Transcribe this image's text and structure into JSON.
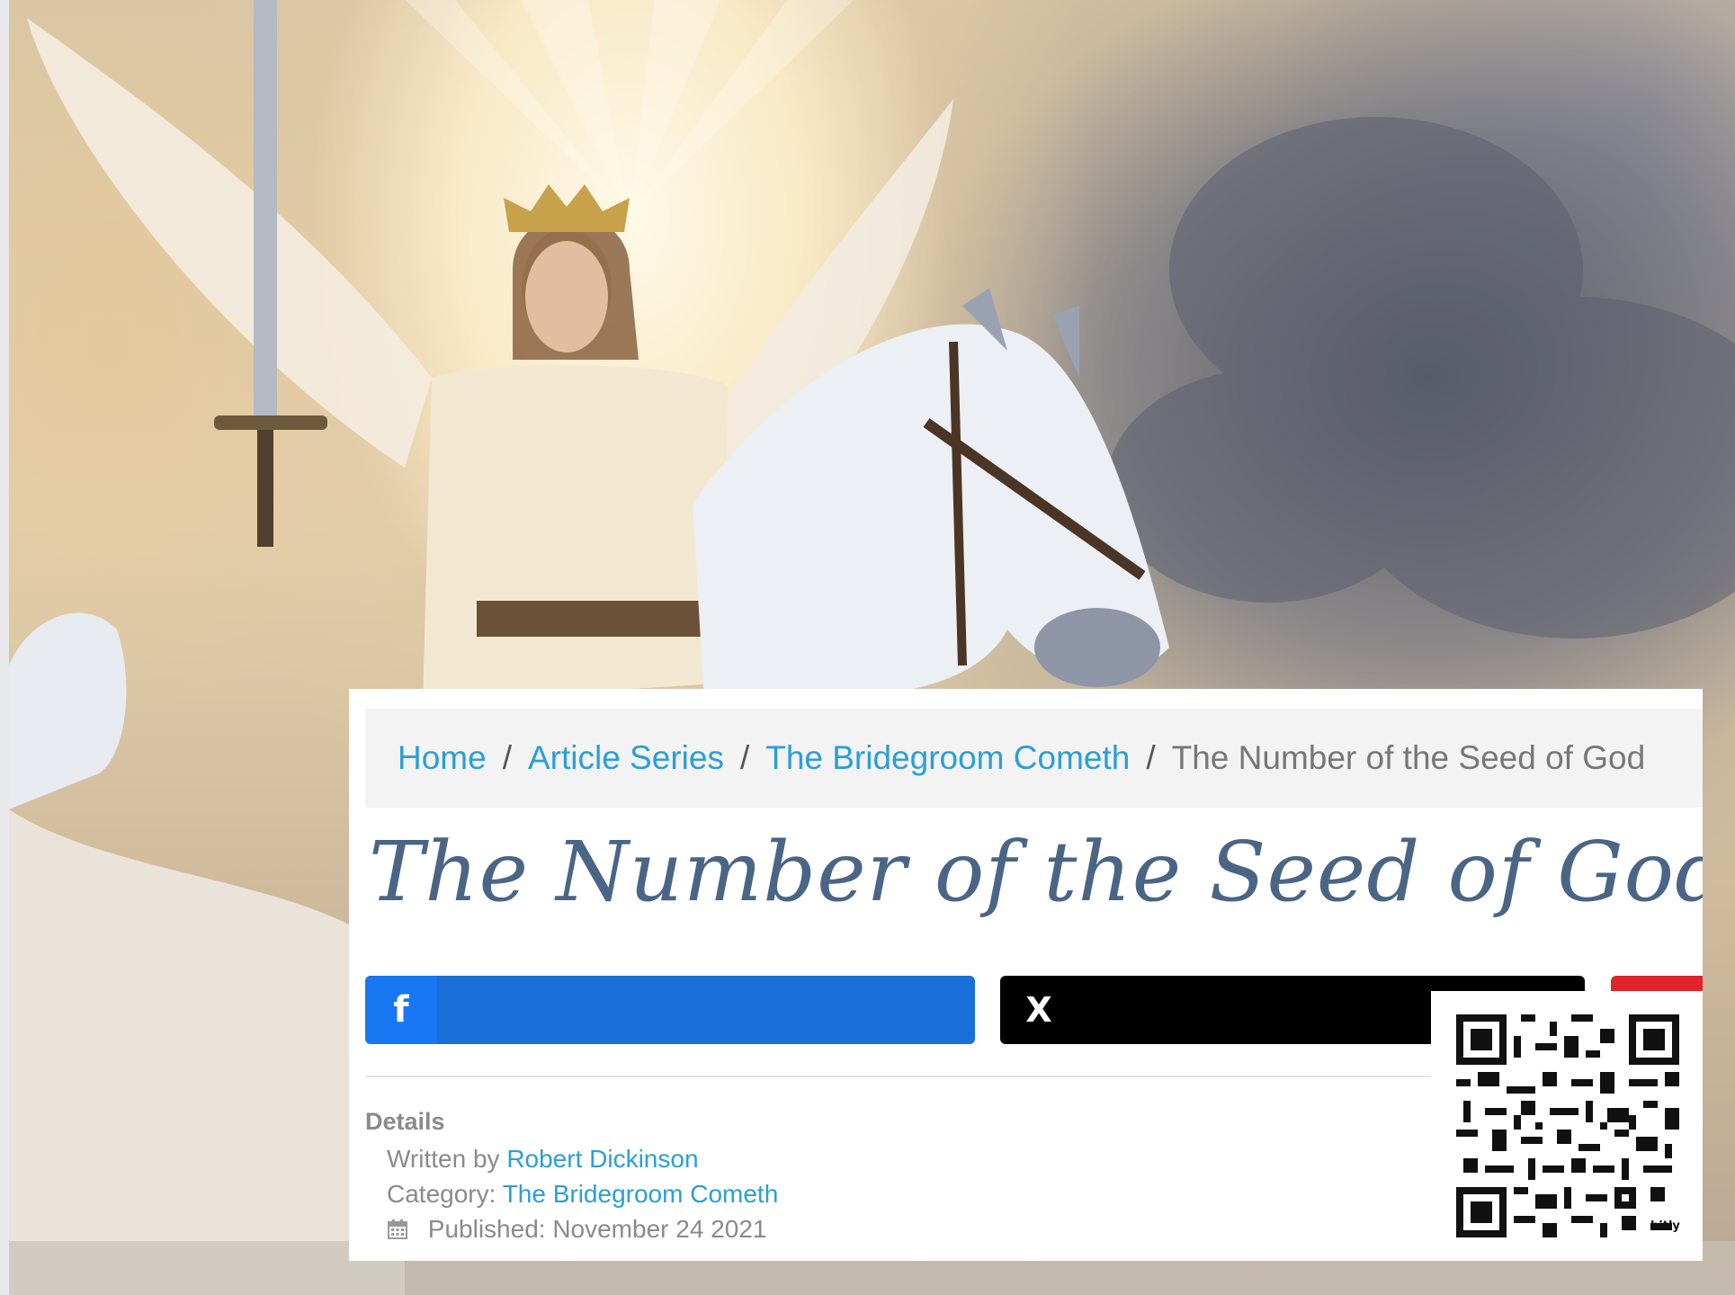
{
  "breadcrumb": {
    "home": "Home",
    "article_series": "Article Series",
    "category": "The Bridegroom Cometh",
    "current": "The Number of the Seed of God",
    "separator": "/"
  },
  "article": {
    "title": "The Number of the Seed of God"
  },
  "share": {
    "facebook_icon": "f",
    "x_icon": "X",
    "colors": {
      "facebook": "#1a6fd8",
      "x": "#000000",
      "third": "#e0242a"
    }
  },
  "details": {
    "heading": "Details",
    "written_by_label": "Written by",
    "author": "Robert Dickinson",
    "category_label": "Category:",
    "category": "The Bridegroom Cometh",
    "published": "Published: November 24 2021"
  },
  "qr": {
    "brand": "bitly"
  },
  "icons": [
    "facebook-icon",
    "x-icon",
    "calendar-icon",
    "qr-code"
  ],
  "accent_color": "#2a9fd6",
  "title_color": "#4a6585"
}
